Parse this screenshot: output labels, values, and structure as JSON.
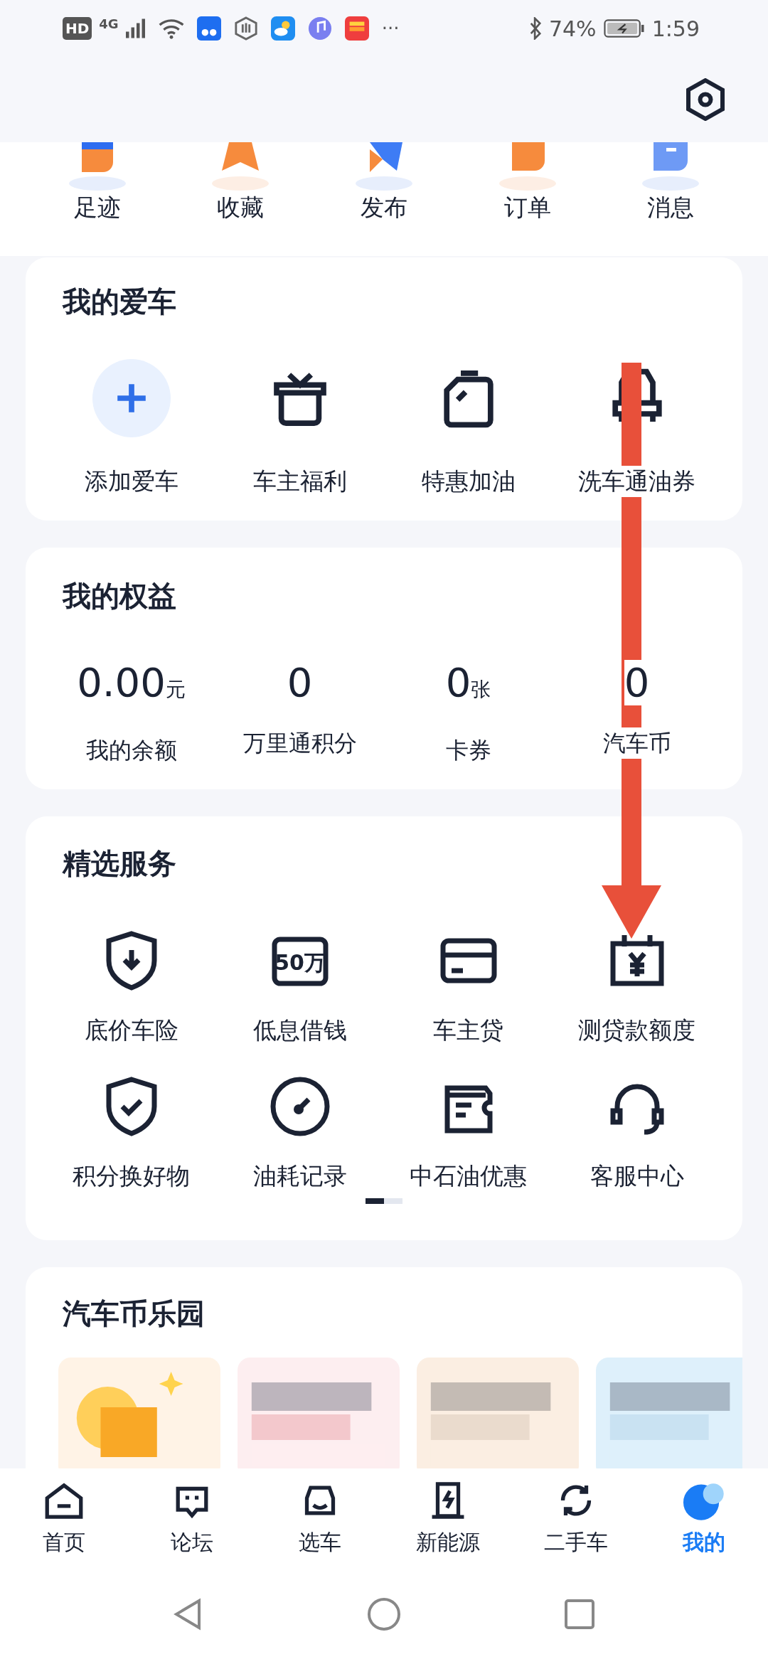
{
  "status_bar": {
    "badges": [
      "HD",
      "4G"
    ],
    "more": "···",
    "battery": "74%",
    "time": "1:59"
  },
  "quick_links": [
    {
      "label": "足迹"
    },
    {
      "label": "收藏"
    },
    {
      "label": "发布"
    },
    {
      "label": "订单"
    },
    {
      "label": "消息"
    }
  ],
  "my_car": {
    "title": "我的爱车",
    "items": [
      {
        "label": "添加爱车"
      },
      {
        "label": "车主福利"
      },
      {
        "label": "特惠加油"
      },
      {
        "label": "洗车通油券"
      }
    ]
  },
  "benefits": {
    "title": "我的权益",
    "items": [
      {
        "value": "0.00",
        "unit": "元",
        "label": "我的余额"
      },
      {
        "value": "0",
        "label": "万里通积分"
      },
      {
        "value": "0",
        "unit": "张",
        "label": "卡券"
      },
      {
        "value": "0",
        "label": "汽车币"
      }
    ]
  },
  "services": {
    "title": "精选服务",
    "items": [
      {
        "label": "底价车险"
      },
      {
        "label": "低息借钱",
        "icon_text": "50万"
      },
      {
        "label": "车主贷"
      },
      {
        "label": "测贷款额度"
      },
      {
        "label": "积分换好物"
      },
      {
        "label": "油耗记录"
      },
      {
        "label": "中石油优惠"
      },
      {
        "label": "客服中心"
      }
    ],
    "pager": [
      {
        "selected": true
      },
      {
        "selected": false
      }
    ]
  },
  "coin_park": {
    "title": "汽车币乐园"
  },
  "tab_bar": [
    {
      "label": "首页",
      "selected": false
    },
    {
      "label": "论坛",
      "selected": false
    },
    {
      "label": "选车",
      "selected": false
    },
    {
      "label": "新能源",
      "selected": false
    },
    {
      "label": "二手车",
      "selected": false
    },
    {
      "label": "我的",
      "selected": true
    }
  ]
}
